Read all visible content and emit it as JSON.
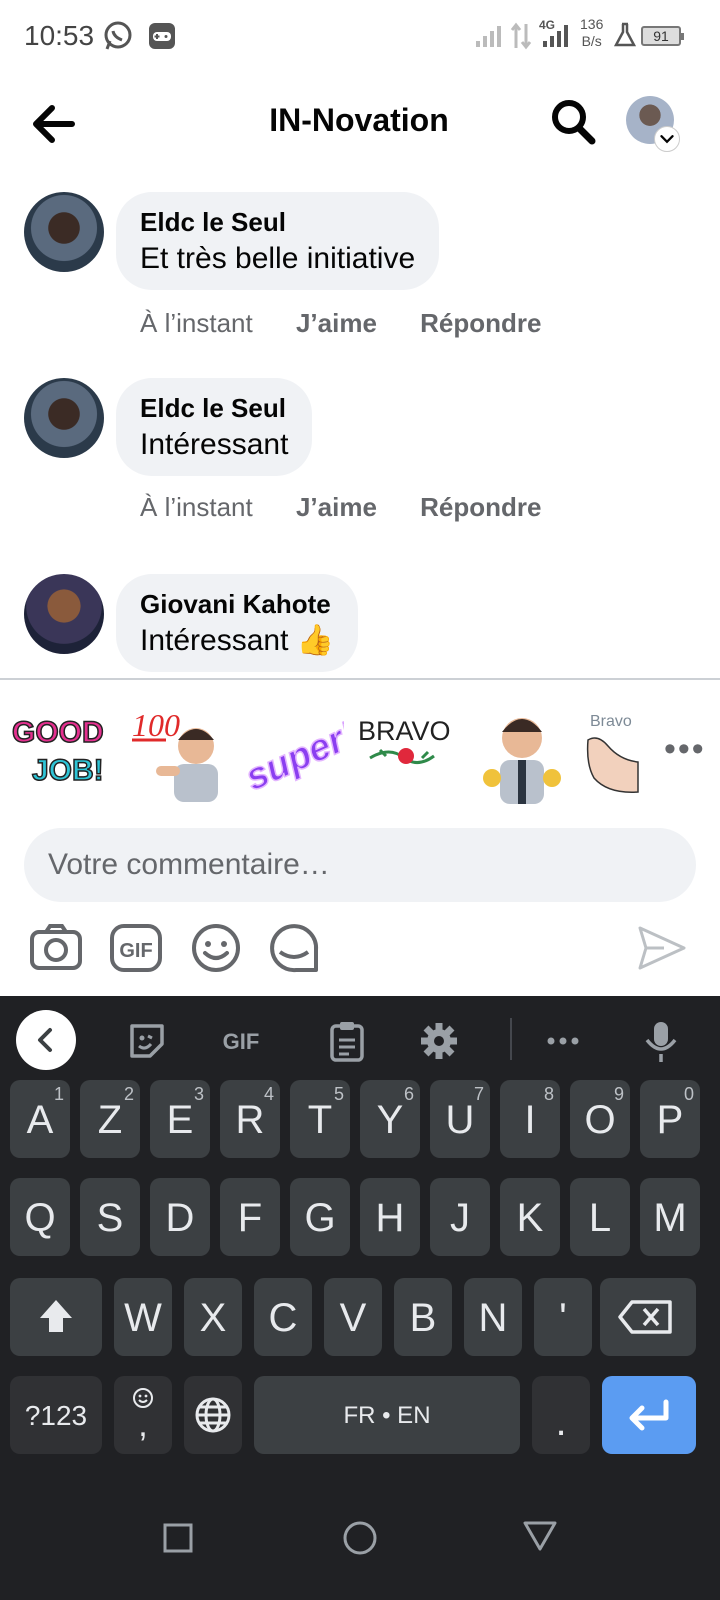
{
  "status_bar": {
    "time": "10:53",
    "network": "4G",
    "speed_value": "136",
    "speed_unit": "B/s",
    "battery": "91"
  },
  "header": {
    "title": "IN-Novation"
  },
  "comments": [
    {
      "name": "Eldc le Seul",
      "text": "Et très belle initiative",
      "time": "À l’instant",
      "like": "J’aime",
      "reply": "Répondre"
    },
    {
      "name": "Eldc le Seul",
      "text": "Intéressant",
      "time": "À l’instant",
      "like": "J’aime",
      "reply": "Répondre"
    },
    {
      "name": "Giovani Kahote",
      "text": "Intéressant 👍"
    }
  ],
  "stickers": [
    {
      "label": "GOOD JOB!",
      "icon": "good-job-sticker"
    },
    {
      "label": "100",
      "icon": "100-avatar-sticker"
    },
    {
      "label": "super!",
      "icon": "super-sticker"
    },
    {
      "label": "BRAVO!",
      "icon": "bravo-rose-sticker"
    },
    {
      "label": "",
      "icon": "thumbs-up-avatar-sticker"
    },
    {
      "label": "Bravo",
      "icon": "bravo-hands-sticker"
    }
  ],
  "comment_input": {
    "placeholder": "Votre commentaire…"
  },
  "keyboard": {
    "gif_label": "GIF",
    "row1": [
      {
        "k": "A",
        "n": "1"
      },
      {
        "k": "Z",
        "n": "2"
      },
      {
        "k": "E",
        "n": "3"
      },
      {
        "k": "R",
        "n": "4"
      },
      {
        "k": "T",
        "n": "5"
      },
      {
        "k": "Y",
        "n": "6"
      },
      {
        "k": "U",
        "n": "7"
      },
      {
        "k": "I",
        "n": "8"
      },
      {
        "k": "O",
        "n": "9"
      },
      {
        "k": "P",
        "n": "0"
      }
    ],
    "row2": [
      "Q",
      "S",
      "D",
      "F",
      "G",
      "H",
      "J",
      "K",
      "L",
      "M"
    ],
    "row3": [
      "W",
      "X",
      "C",
      "V",
      "B",
      "N",
      "'"
    ],
    "symbols_key": "?123",
    "comma_key": ",",
    "space_key": "FR • EN",
    "period_key": "."
  }
}
